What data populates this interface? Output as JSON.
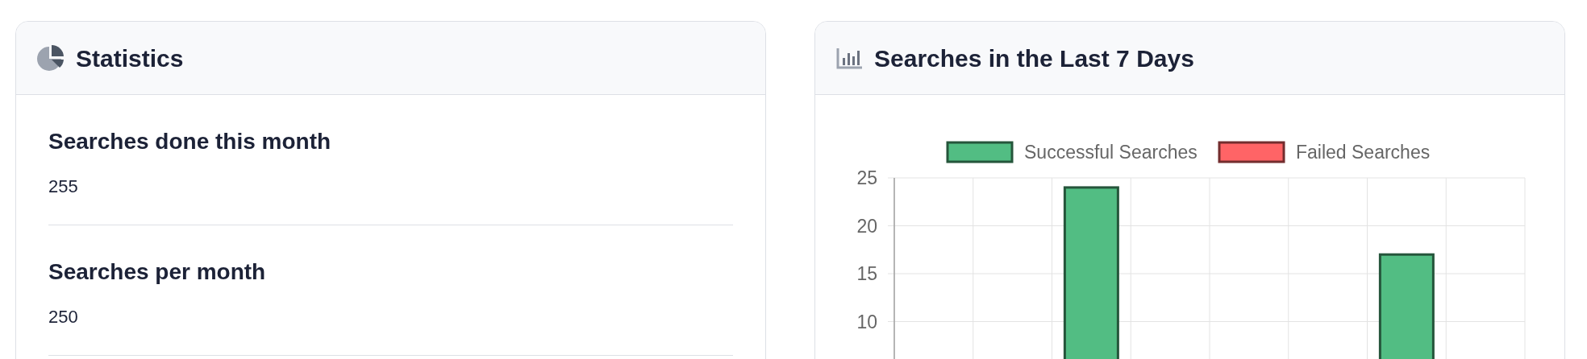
{
  "statistics_card": {
    "title": "Statistics",
    "items": [
      {
        "label": "Searches done this month",
        "value": "255"
      },
      {
        "label": "Searches per month",
        "value": "250"
      }
    ]
  },
  "chart_card": {
    "title": "Searches in the Last 7 Days",
    "chart_data": {
      "type": "bar",
      "grid": true,
      "ylim": [
        0,
        25
      ],
      "yticks": [
        10,
        15,
        20,
        25
      ],
      "series": [
        {
          "name": "Successful Searches",
          "color": "#52bd83",
          "values": [
            null,
            null,
            24,
            null,
            null,
            null,
            17,
            null
          ]
        },
        {
          "name": "Failed Searches",
          "color": "#ff6466",
          "values": [
            null,
            null,
            null,
            null,
            null,
            null,
            null,
            null
          ]
        }
      ]
    }
  }
}
